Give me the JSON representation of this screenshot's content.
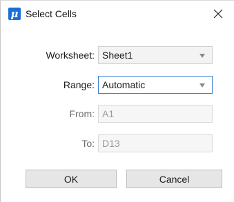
{
  "window": {
    "title": "Select Cells",
    "app_icon_glyph": "μ",
    "app_icon": "app-logo-icon",
    "close_icon": "close-icon"
  },
  "form": {
    "worksheet": {
      "label": "Worksheet:",
      "value": "Sheet1"
    },
    "range": {
      "label": "Range:",
      "value": "Automatic"
    },
    "from": {
      "label": "From:",
      "value": "A1"
    },
    "to": {
      "label": "To:",
      "value": "D13"
    }
  },
  "buttons": {
    "ok": "OK",
    "cancel": "Cancel"
  },
  "colors": {
    "accent": "#1b6fd8",
    "focus_border": "#3c7fd5",
    "disabled_text": "#9a9a9a"
  }
}
